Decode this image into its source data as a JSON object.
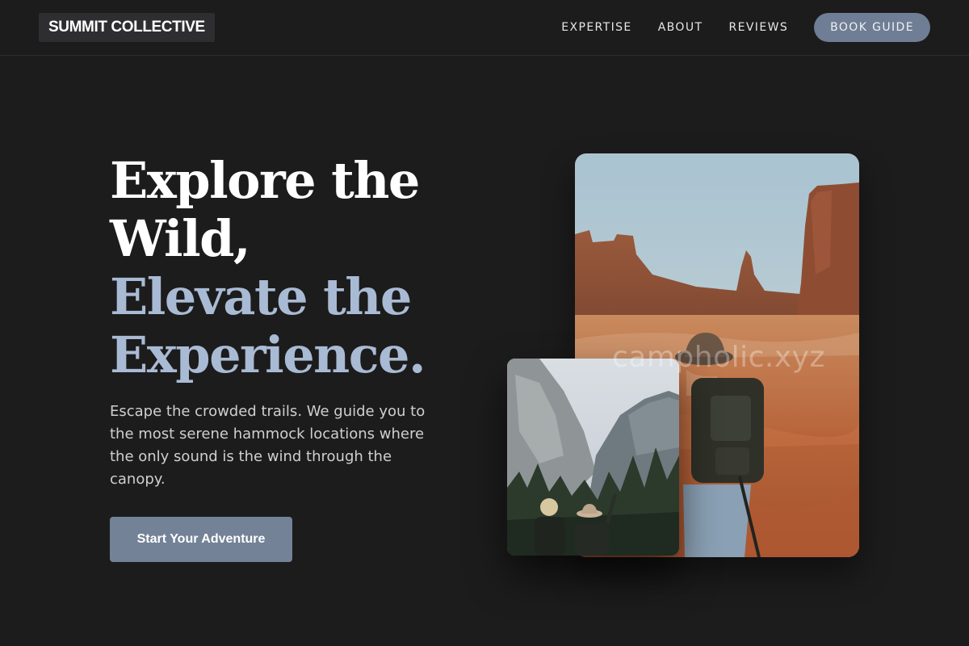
{
  "header": {
    "logo": "SUMMIT COLLECTIVE",
    "nav": [
      {
        "label": "EXPERTISE"
      },
      {
        "label": "ABOUT"
      },
      {
        "label": "REVIEWS"
      }
    ],
    "cta_label": "BOOK GUIDE"
  },
  "hero": {
    "title_line1": "Explore the Wild,",
    "title_line2": "Elevate the Experience.",
    "description": "Escape the crowded trails. We guide you to the most serene hammock locations where the only sound is the wind through the canopy.",
    "button_label": "Start Your Adventure"
  },
  "images": {
    "watermark": "campholic.xyz"
  },
  "colors": {
    "background": "#1c1c1c",
    "accent": "#738297",
    "title_highlight": "#a9bad4"
  }
}
